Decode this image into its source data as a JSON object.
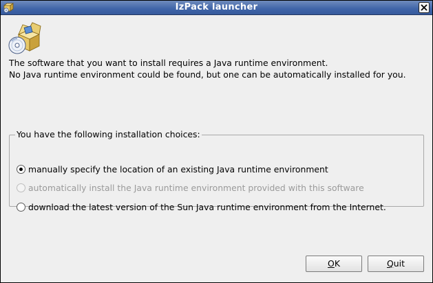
{
  "window": {
    "title": "IzPack launcher",
    "title_icon": "app-package-icon",
    "close_icon": "close-icon"
  },
  "message": {
    "line1": "The software that you want to install requires a Java runtime environment.",
    "line2": "No Java runtime environment could be found, but one can be automatically installed for you."
  },
  "choices": {
    "legend": "You have the following installation choices:",
    "options": [
      {
        "label": "manually specify the location of an existing Java runtime environment",
        "selected": true,
        "enabled": true
      },
      {
        "label": "automatically install the Java runtime environment provided with this software",
        "selected": false,
        "enabled": false
      },
      {
        "label": "download the latest version of the Sun Java runtime environment from the Internet.",
        "selected": false,
        "enabled": true
      }
    ]
  },
  "buttons": {
    "ok_mnemonic": "O",
    "ok_rest": "K",
    "quit_mnemonic": "Q",
    "quit_rest": "uit"
  },
  "colors": {
    "titlebar": "#3f64a8",
    "background": "#efefef",
    "disabled_text": "#9a9a9a"
  }
}
